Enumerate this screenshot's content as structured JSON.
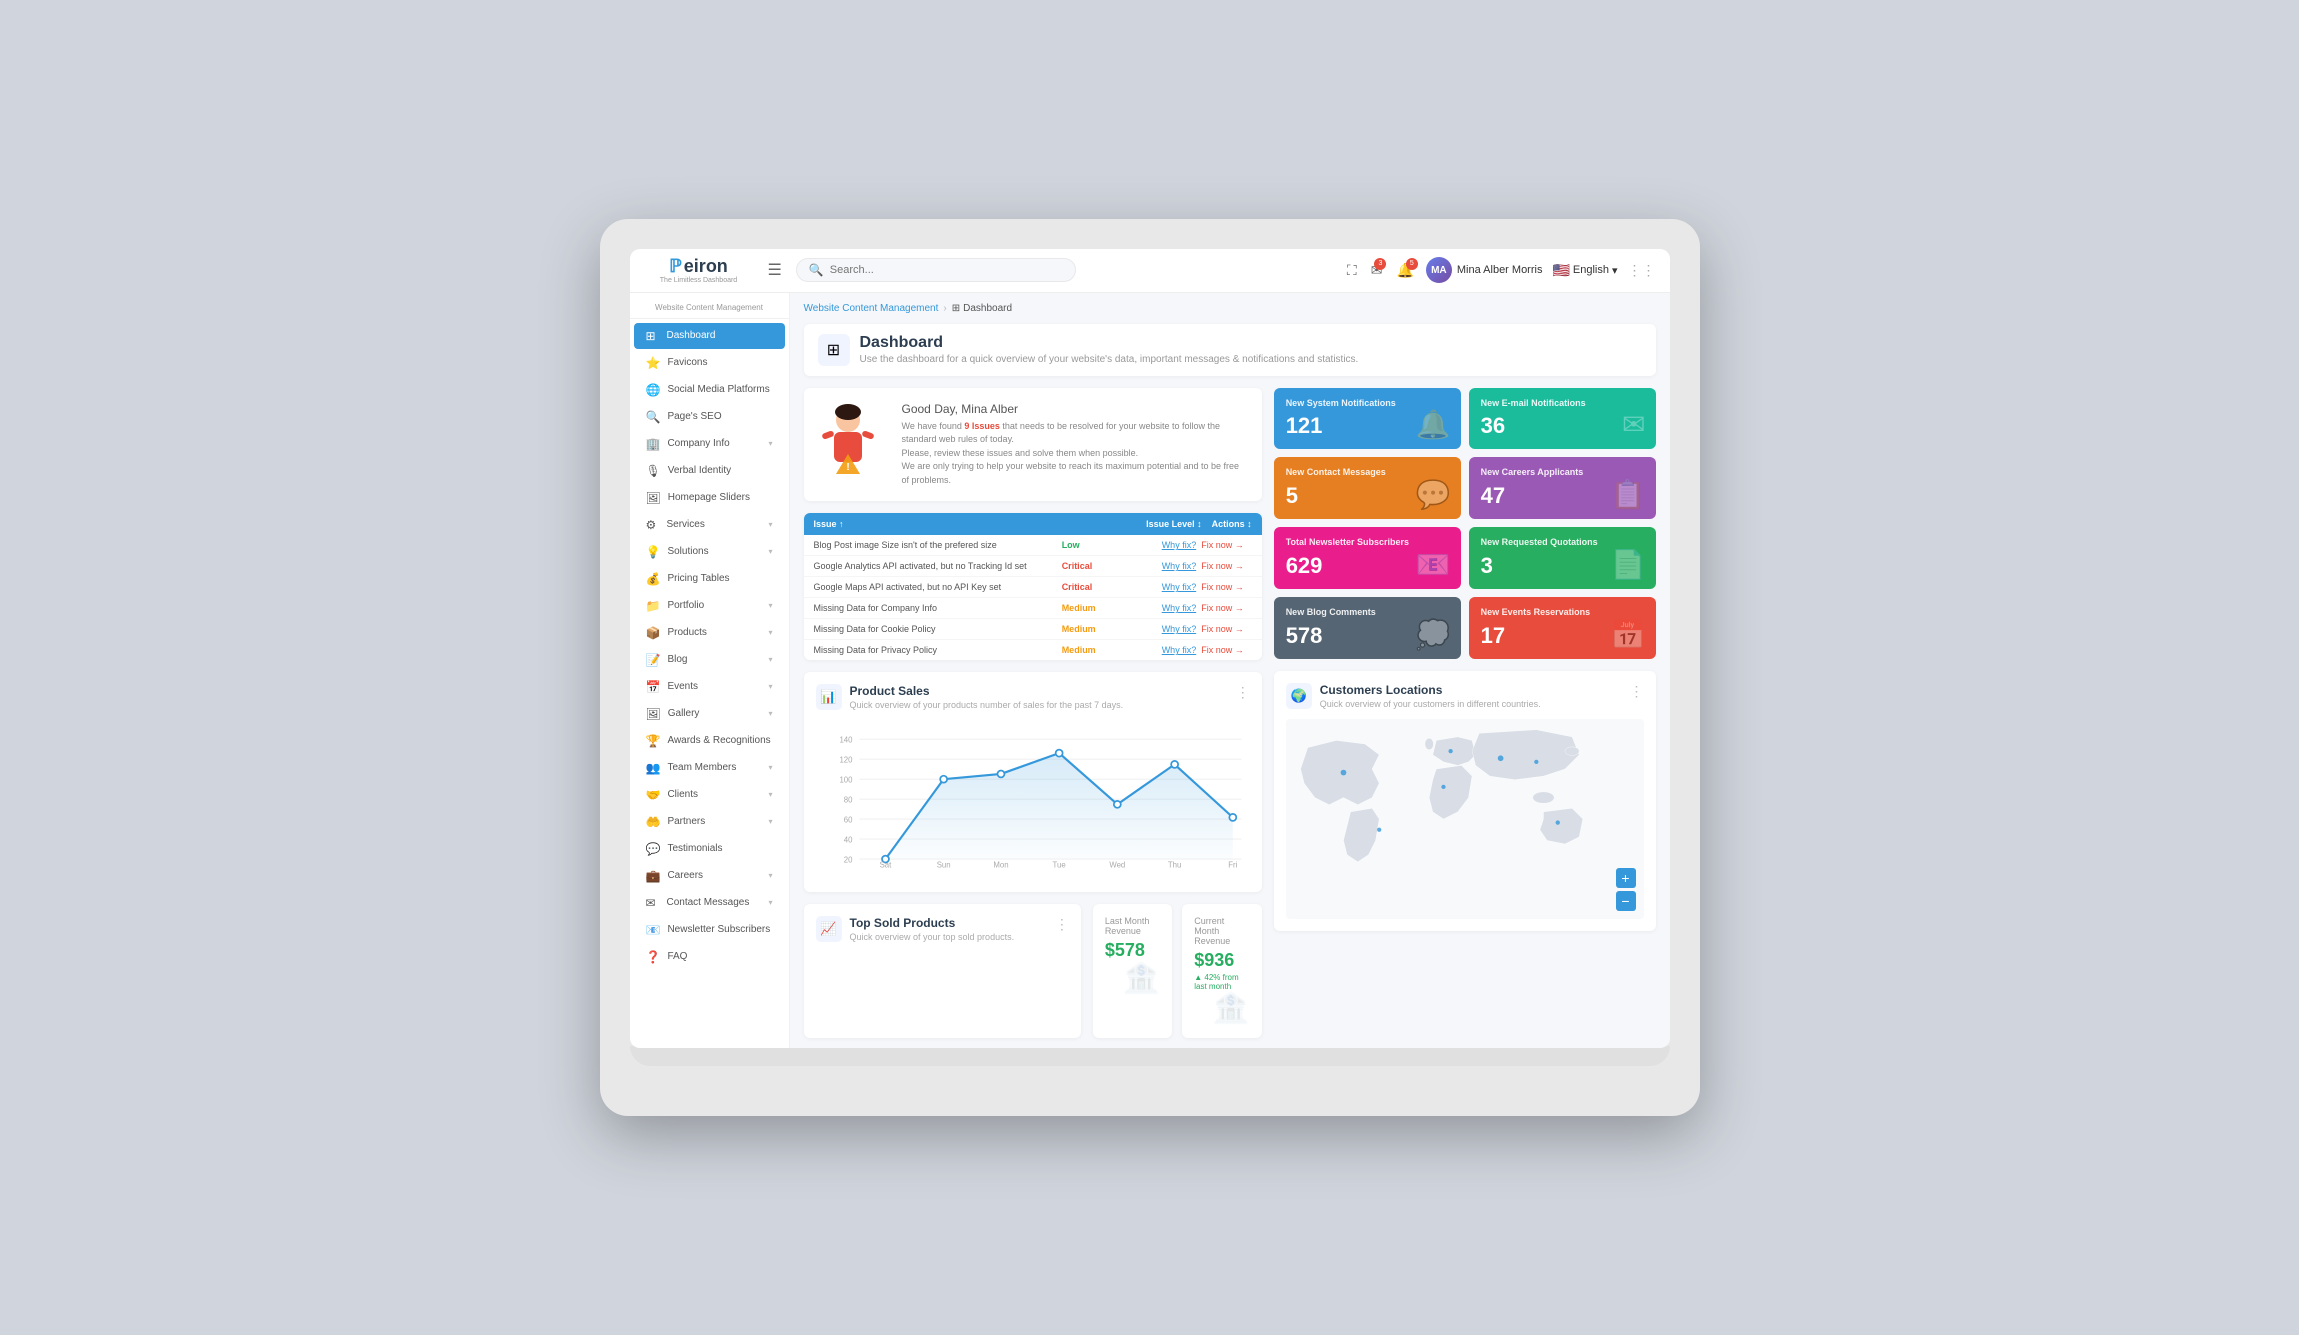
{
  "app": {
    "logo_brand": "eiron",
    "logo_subtitle": "The Limitless Dashboard",
    "section_title": "Website Content Management"
  },
  "topbar": {
    "search_placeholder": "Search...",
    "hamburger_label": "☰",
    "user_name": "Mina Alber Morris",
    "user_initials": "MA",
    "language": "English",
    "expand_icon": "⛶",
    "mail_icon": "✉",
    "bell_icon": "🔔",
    "grid_icon": "⋮⋮⋮"
  },
  "breadcrumb": {
    "parent": "Website Content Management",
    "separator": "›",
    "current": "Dashboard"
  },
  "page": {
    "title": "Dashboard",
    "subtitle": "Use the dashboard for a quick overview of your website's data, important messages & notifications and statistics."
  },
  "welcome": {
    "greeting": "Good Day, Mina Alber",
    "issues_count": "9 Issues",
    "description": "We have found 9 Issues that needs to be resolved for your website to follow the standard web rules of today.\nPlease, review these issues and solve them when possible.\nWe are only trying to help your website to reach its maximum potential and to be free of problems."
  },
  "issues_table": {
    "headers": [
      "Issue ↑",
      "Issue Level ↕",
      "Actions ↕"
    ],
    "rows": [
      {
        "issue": "Blog Post image Size isn't of the prefered size",
        "level": "Low",
        "level_class": "level-low",
        "why": "Why fix?",
        "fix": "Fix now →"
      },
      {
        "issue": "Google Analytics API activated, but no Tracking Id set",
        "level": "Critical",
        "level_class": "level-critical",
        "why": "Why fix?",
        "fix": "Fix now →"
      },
      {
        "issue": "Google Maps API activated, but no API Key set",
        "level": "Critical",
        "level_class": "level-critical",
        "why": "Why fix?",
        "fix": "Fix now →"
      },
      {
        "issue": "Missing Data for Company Info",
        "level": "Medium",
        "level_class": "level-medium",
        "why": "Why fix?",
        "fix": "Fix now →"
      },
      {
        "issue": "Missing Data for Cookie Policy",
        "level": "Medium",
        "level_class": "level-medium",
        "why": "Why fix?",
        "fix": "Fix now →"
      },
      {
        "issue": "Missing Data for Privacy Policy",
        "level": "Medium",
        "level_class": "level-medium",
        "why": "Why fix?",
        "fix": "Fix now →"
      }
    ]
  },
  "stat_cards": [
    {
      "id": "new-system-notif",
      "label": "New System Notifications",
      "value": "121",
      "color": "card-blue",
      "icon": "🔔"
    },
    {
      "id": "new-email-notif",
      "label": "New E-mail Notifications",
      "value": "36",
      "color": "card-teal",
      "icon": "✉"
    },
    {
      "id": "new-contact-msg",
      "label": "New Contact Messages",
      "value": "5",
      "color": "card-orange",
      "icon": "💬"
    },
    {
      "id": "new-careers",
      "label": "New Careers Applicants",
      "value": "47",
      "color": "card-purple",
      "icon": "📋"
    },
    {
      "id": "newsletter-subs",
      "label": "Total Newsletter Subscribers",
      "value": "629",
      "color": "card-pink",
      "icon": "📧"
    },
    {
      "id": "quotations",
      "label": "New Requested Quotations",
      "value": "3",
      "color": "card-green",
      "icon": "📄"
    },
    {
      "id": "blog-comments",
      "label": "New Blog Comments",
      "value": "578",
      "color": "card-dark",
      "icon": "💭"
    },
    {
      "id": "events-res",
      "label": "New Events Reservations",
      "value": "17",
      "color": "card-red",
      "icon": "📅"
    }
  ],
  "product_sales": {
    "title": "Product Sales",
    "subtitle": "Quick overview of your products number of sales for the past 7 days.",
    "x_labels": [
      "Sat",
      "Sun",
      "Mon",
      "Tue",
      "Wed",
      "Thu",
      "Fri"
    ],
    "y_labels": [
      "140",
      "120",
      "100",
      "80",
      "60",
      "40",
      "20"
    ],
    "data_points": [
      20,
      104,
      110,
      128,
      86,
      118,
      70
    ]
  },
  "customers_locations": {
    "title": "Customers Locations",
    "subtitle": "Quick overview of your customers in different countries."
  },
  "top_sold": {
    "title": "Top Sold Products",
    "subtitle": "Quick overview of your top sold products."
  },
  "revenue": {
    "last_month_label": "Last Month Revenue",
    "last_month_value": "$578",
    "current_month_label": "Current Month Revenue",
    "current_month_value": "$936",
    "trend": "42% from last month"
  },
  "sidebar": {
    "items": [
      {
        "id": "dashboard",
        "label": "Dashboard",
        "icon": "⊞",
        "active": true,
        "has_children": false
      },
      {
        "id": "favicons",
        "label": "Favicons",
        "icon": "⭐",
        "active": false,
        "has_children": false
      },
      {
        "id": "social-media",
        "label": "Social Media Platforms",
        "icon": "🌐",
        "active": false,
        "has_children": false
      },
      {
        "id": "pages-seo",
        "label": "Page's SEO",
        "icon": "🔍",
        "active": false,
        "has_children": false
      },
      {
        "id": "company-info",
        "label": "Company Info",
        "icon": "🏢",
        "active": false,
        "has_children": true
      },
      {
        "id": "verbal-identity",
        "label": "Verbal Identity",
        "icon": "🎙",
        "active": false,
        "has_children": false
      },
      {
        "id": "homepage-sliders",
        "label": "Homepage Sliders",
        "icon": "🖼",
        "active": false,
        "has_children": false
      },
      {
        "id": "services",
        "label": "Services",
        "icon": "⚙",
        "active": false,
        "has_children": true
      },
      {
        "id": "solutions",
        "label": "Solutions",
        "icon": "💡",
        "active": false,
        "has_children": true
      },
      {
        "id": "pricing-tables",
        "label": "Pricing Tables",
        "icon": "💰",
        "active": false,
        "has_children": false
      },
      {
        "id": "portfolio",
        "label": "Portfolio",
        "icon": "📁",
        "active": false,
        "has_children": true
      },
      {
        "id": "products",
        "label": "Products",
        "icon": "📦",
        "active": false,
        "has_children": true
      },
      {
        "id": "blog",
        "label": "Blog",
        "icon": "📝",
        "active": false,
        "has_children": true
      },
      {
        "id": "events",
        "label": "Events",
        "icon": "📅",
        "active": false,
        "has_children": true
      },
      {
        "id": "gallery",
        "label": "Gallery",
        "icon": "🖼",
        "active": false,
        "has_children": true
      },
      {
        "id": "awards",
        "label": "Awards & Recognitions",
        "icon": "🏆",
        "active": false,
        "has_children": false
      },
      {
        "id": "team-members",
        "label": "Team Members",
        "icon": "👥",
        "active": false,
        "has_children": true
      },
      {
        "id": "clients",
        "label": "Clients",
        "icon": "🤝",
        "active": false,
        "has_children": true
      },
      {
        "id": "partners",
        "label": "Partners",
        "icon": "🤲",
        "active": false,
        "has_children": true
      },
      {
        "id": "testimonials",
        "label": "Testimonials",
        "icon": "💬",
        "active": false,
        "has_children": false
      },
      {
        "id": "careers",
        "label": "Careers",
        "icon": "💼",
        "active": false,
        "has_children": true
      },
      {
        "id": "contact-messages",
        "label": "Contact Messages",
        "icon": "✉",
        "active": false,
        "has_children": true
      },
      {
        "id": "newsletter",
        "label": "Newsletter Subscribers",
        "icon": "📧",
        "active": false,
        "has_children": false
      },
      {
        "id": "faq",
        "label": "FAQ",
        "icon": "❓",
        "active": false,
        "has_children": false
      }
    ]
  }
}
